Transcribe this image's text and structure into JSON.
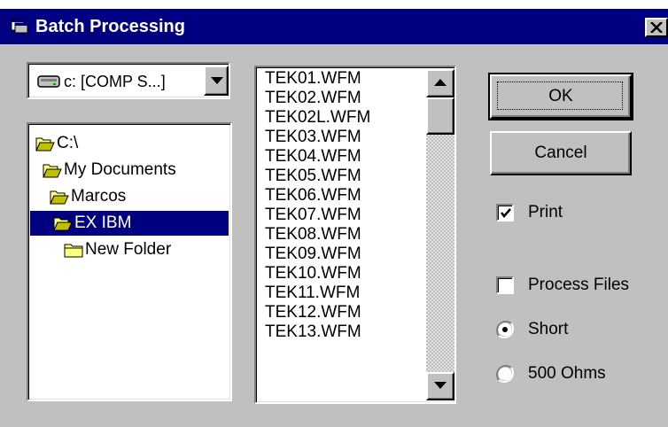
{
  "window": {
    "title": "Batch Processing"
  },
  "drive": {
    "selected": "c: [COMP S...]"
  },
  "directories": [
    {
      "label": "C:\\",
      "selected": false,
      "open": true
    },
    {
      "label": "My Documents",
      "selected": false,
      "open": true
    },
    {
      "label": "Marcos",
      "selected": false,
      "open": true
    },
    {
      "label": "EX IBM",
      "selected": true,
      "open": true
    },
    {
      "label": "New Folder",
      "selected": false,
      "open": false
    }
  ],
  "files": [
    "TEK01.WFM",
    "TEK02.WFM",
    "TEK02L.WFM",
    "TEK03.WFM",
    "TEK04.WFM",
    "TEK05.WFM",
    "TEK06.WFM",
    "TEK07.WFM",
    "TEK08.WFM",
    "TEK09.WFM",
    "TEK10.WFM",
    "TEK11.WFM",
    "TEK12.WFM",
    "TEK13.WFM"
  ],
  "buttons": {
    "ok": "OK",
    "cancel": "Cancel"
  },
  "options": {
    "print": {
      "label": "Print",
      "checked": true
    },
    "process_files": {
      "label": "Process Files",
      "checked": false
    },
    "mode": {
      "short": {
        "label": "Short",
        "selected": true
      },
      "ohms": {
        "label": "500 Ohms",
        "selected": false
      }
    }
  },
  "icons": {
    "title": "batch-window-icon",
    "drive": "hard-drive-icon",
    "folder_open": "folder-open-icon",
    "folder_closed": "folder-closed-icon",
    "close": "close-icon"
  },
  "colors": {
    "titlebar": "#000080",
    "face": "#c0c0c0",
    "selection": "#000080"
  }
}
